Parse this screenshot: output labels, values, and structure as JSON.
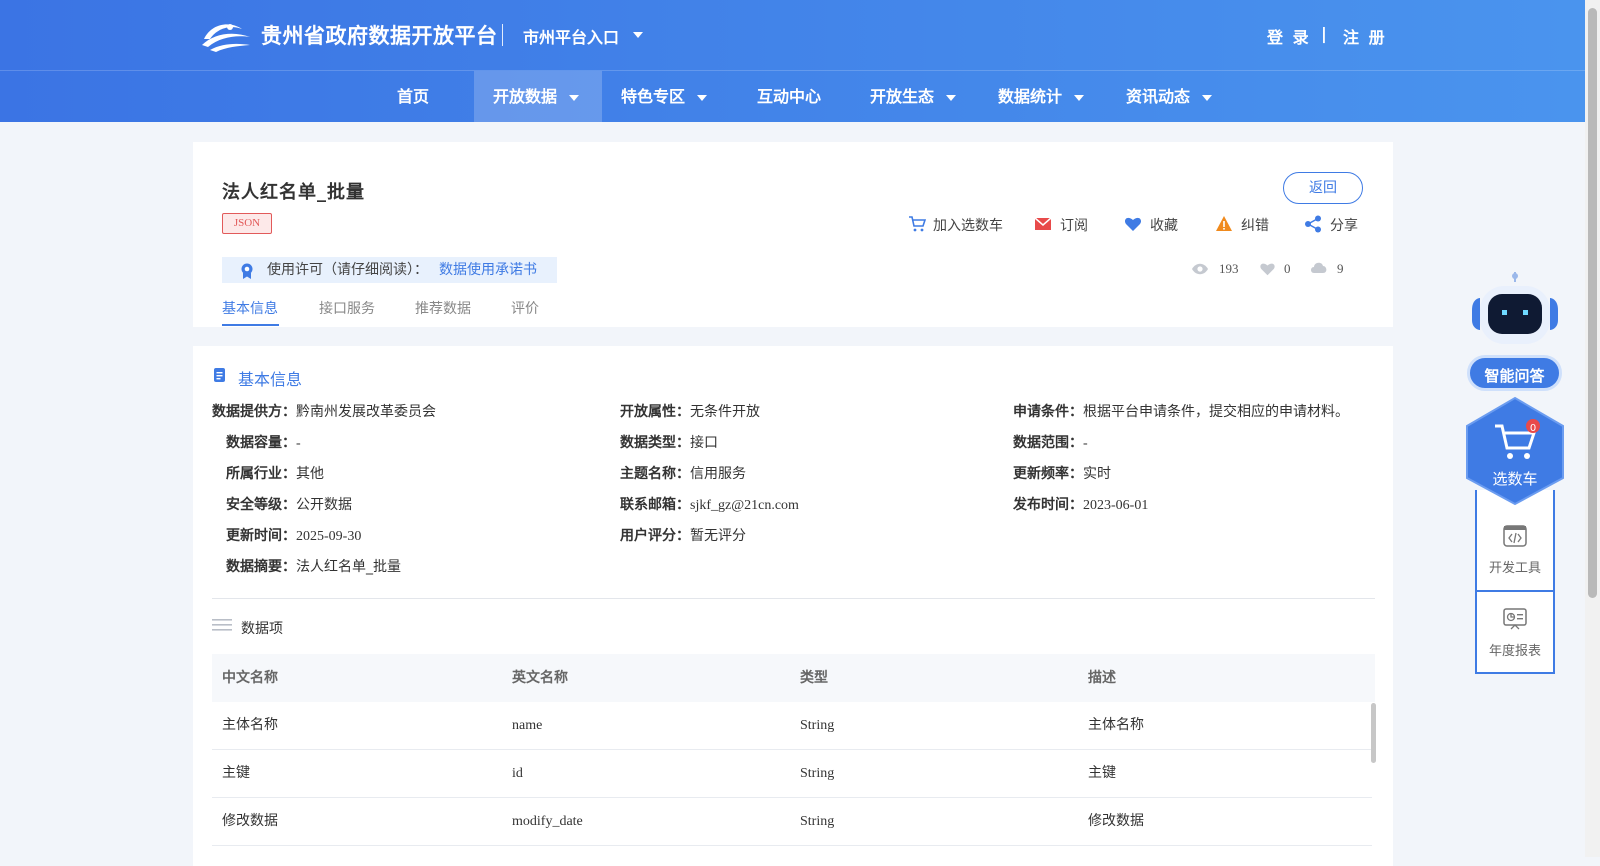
{
  "header": {
    "site_title": "贵州省政府数据开放平台",
    "city_portal": "市州平台入口",
    "login": "登 录",
    "separator": "|",
    "register": "注 册",
    "brand_color": "#3b74e4"
  },
  "nav": {
    "items": [
      {
        "label": "首页"
      },
      {
        "label": "开放数据"
      },
      {
        "label": "特色专区"
      },
      {
        "label": "互动中心"
      },
      {
        "label": "开放生态"
      },
      {
        "label": "数据统计"
      },
      {
        "label": "资讯动态"
      }
    ],
    "active": "开放数据"
  },
  "dataset": {
    "title": "法人红名单_批量",
    "format_tag": "JSON",
    "back_label": "返回",
    "actions": [
      {
        "label": "加入选数车",
        "icon": "cart-icon"
      },
      {
        "label": "订阅",
        "icon": "mail-icon"
      },
      {
        "label": "收藏",
        "icon": "heart-icon"
      },
      {
        "label": "纠错",
        "icon": "warning-icon"
      },
      {
        "label": "分享",
        "icon": "share-icon"
      }
    ],
    "license_label": "使用许可（请仔细阅读）：",
    "license_link": "数据使用承诺书",
    "stats": {
      "views": "193",
      "likes": "0",
      "downloads": "9"
    },
    "tabs": [
      "基本信息",
      "接口服务",
      "推荐数据",
      "评价"
    ],
    "active_tab": "基本信息"
  },
  "basic_info": {
    "section_title": "基本信息",
    "fields": [
      {
        "key": "数据提供方：",
        "value": "黔南州发展改革委员会"
      },
      {
        "key": "开放属性：",
        "value": "无条件开放"
      },
      {
        "key": "申请条件：",
        "value": "根据平台申请条件，提交相应的申请材料。"
      },
      {
        "key": "数据容量：",
        "value": "-"
      },
      {
        "key": "数据类型：",
        "value": "接口"
      },
      {
        "key": "数据范围：",
        "value": "-"
      },
      {
        "key": "所属行业：",
        "value": "其他"
      },
      {
        "key": "主题名称：",
        "value": "信用服务"
      },
      {
        "key": "更新频率：",
        "value": "实时"
      },
      {
        "key": "安全等级：",
        "value": "公开数据"
      },
      {
        "key": "联系邮箱：",
        "value": "sjkf_gz@21cn.com"
      },
      {
        "key": "发布时间：",
        "value": "2023-06-01"
      },
      {
        "key": "更新时间：",
        "value": "2025-09-30"
      },
      {
        "key": "用户评分：",
        "value": "暂无评分"
      },
      {
        "key": "数据摘要：",
        "value": "法人红名单_批量"
      }
    ]
  },
  "data_items": {
    "title": "数据项",
    "columns": [
      "中文名称",
      "英文名称",
      "类型",
      "描述"
    ],
    "rows": [
      [
        "主体名称",
        "name",
        "String",
        "主体名称"
      ],
      [
        "主键",
        "id",
        "String",
        "主键"
      ],
      [
        "修改数据",
        "modify_date",
        "String",
        "修改数据"
      ]
    ]
  },
  "side": {
    "qa_label": "智能问答",
    "cart_label": "选数车",
    "cart_count": "0",
    "dev_tools": "开发工具",
    "annual_report": "年度报表"
  }
}
